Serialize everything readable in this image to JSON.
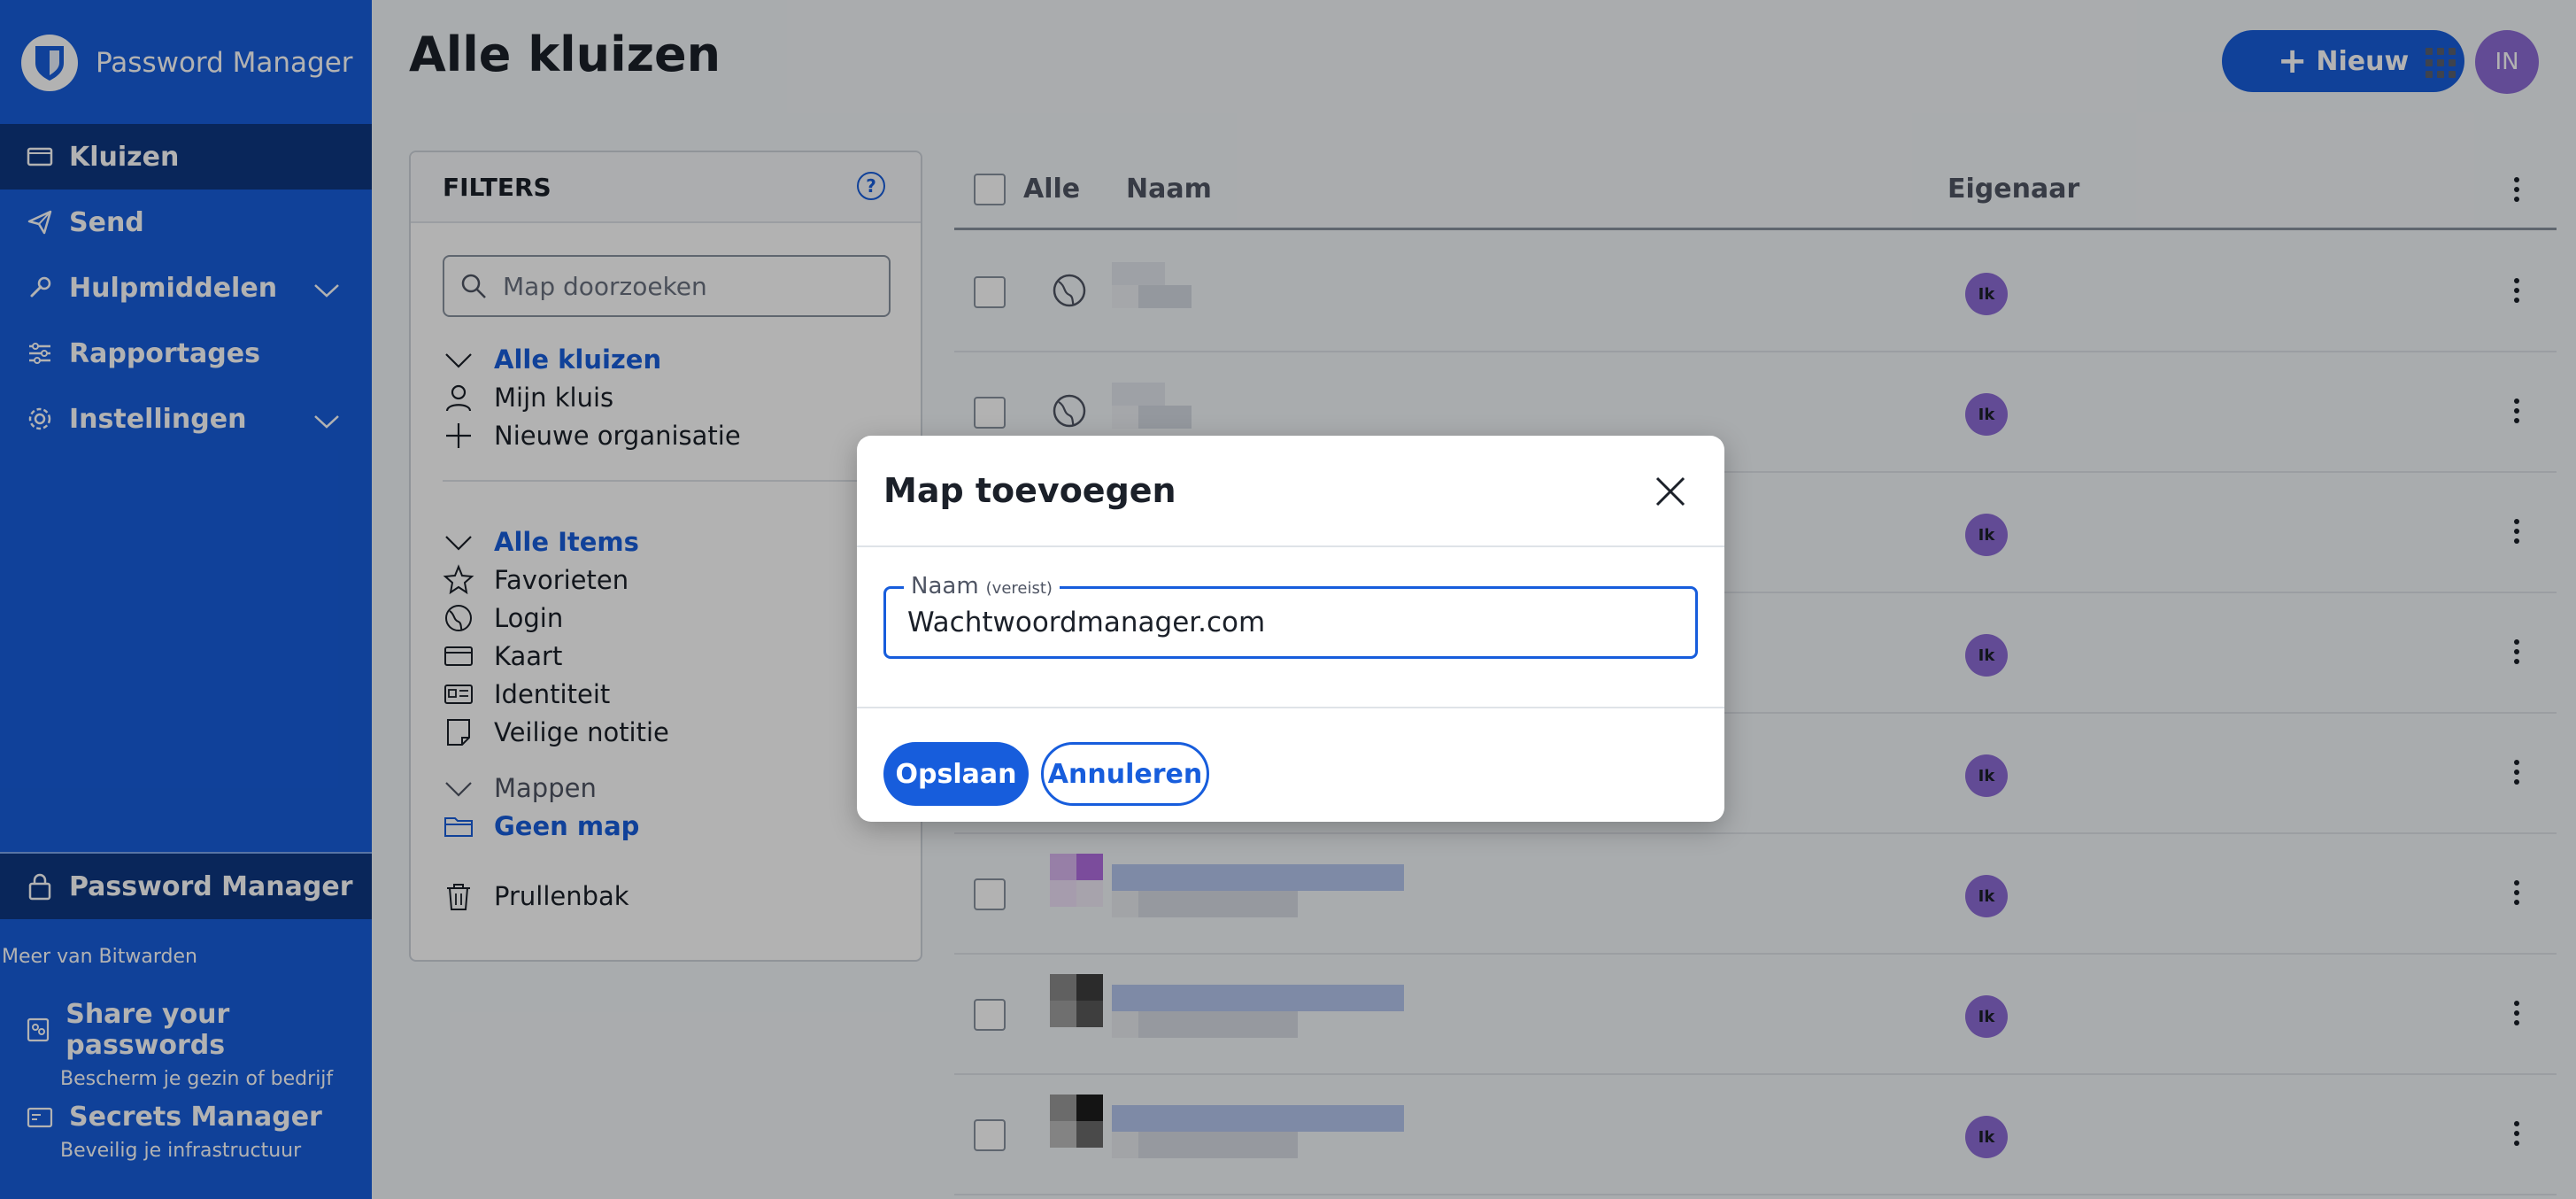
{
  "sidebar": {
    "brand": "Password Manager",
    "nav": [
      {
        "label": "Kluizen",
        "icon": "vault-icon",
        "active": true
      },
      {
        "label": "Send",
        "icon": "send-icon"
      },
      {
        "label": "Hulpmiddelen",
        "icon": "wrench-icon",
        "expandable": true
      },
      {
        "label": "Rapportages",
        "icon": "sliders-icon"
      },
      {
        "label": "Instellingen",
        "icon": "gear-icon",
        "expandable": true
      }
    ],
    "product_switcher": "Password Manager",
    "more_label": "Meer van Bitwarden",
    "promos": [
      {
        "title": "Share your passwords",
        "subtitle": "Bescherm je gezin of bedrijf",
        "icon": "family-icon"
      },
      {
        "title": "Secrets Manager",
        "subtitle": "Beveilig je infrastructuur",
        "icon": "secrets-icon"
      }
    ]
  },
  "header": {
    "title": "Alle kluizen",
    "new_button": "Nieuw",
    "avatar_initials": "IN"
  },
  "filters": {
    "title": "FILTERS",
    "search_placeholder": "Map doorzoeken",
    "vaults": {
      "header": "Alle kluizen",
      "items": [
        "Mijn kluis",
        "Nieuwe organisatie"
      ]
    },
    "types": {
      "header": "Alle Items",
      "items": [
        "Favorieten",
        "Login",
        "Kaart",
        "Identiteit",
        "Veilige notitie"
      ]
    },
    "folders": {
      "header": "Mappen",
      "items": [
        "Geen map"
      ]
    },
    "trash": "Prullenbak"
  },
  "table": {
    "col_all": "Alle",
    "col_name": "Naam",
    "col_owner": "Eigenaar",
    "owner_badge": "Ik"
  },
  "dialog": {
    "title": "Map toevoegen",
    "field_label": "Naam",
    "field_required": "(vereist)",
    "field_value": "Wachtwoordmanager.com",
    "save": "Opslaan",
    "cancel": "Annuleren"
  },
  "colors": {
    "brand": "#175ddc",
    "sidebar_active": "#0e3781",
    "avatar": "#8d6cd6"
  }
}
